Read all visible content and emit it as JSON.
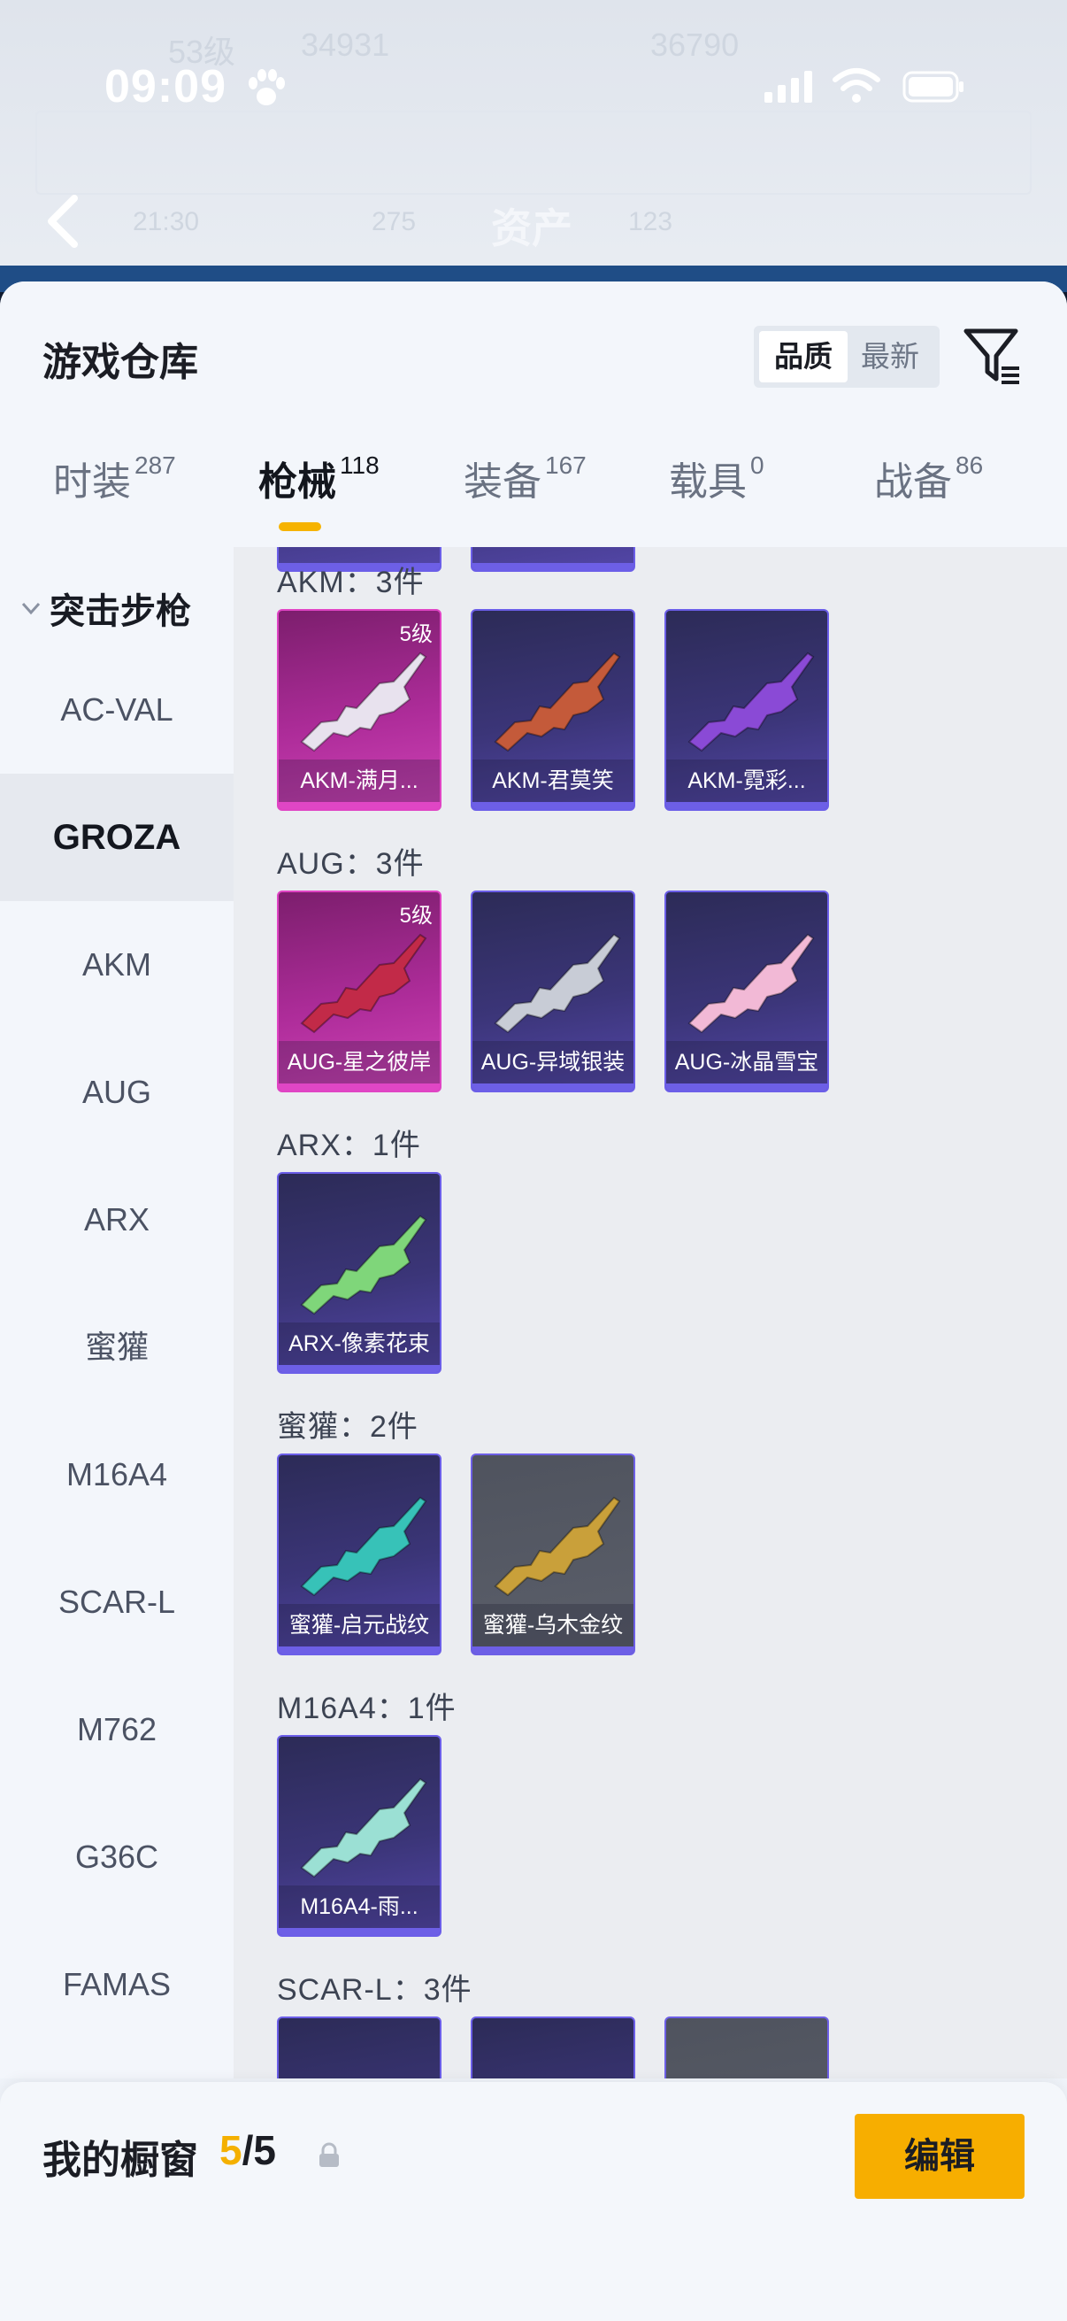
{
  "status_bar": {
    "time": "09:09"
  },
  "background_header": {
    "title": "资产",
    "ghost_text": [
      "53级",
      "34931",
      "36790",
      "21:30",
      "275",
      "123"
    ]
  },
  "sheet": {
    "title": "游戏仓库",
    "sort": {
      "options": [
        "品质",
        "最新"
      ],
      "selected": "品质"
    }
  },
  "tabs": [
    {
      "label": "时装",
      "count": "287"
    },
    {
      "label": "枪械",
      "count": "118",
      "active": true
    },
    {
      "label": "装备",
      "count": "167"
    },
    {
      "label": "载具",
      "count": "0"
    },
    {
      "label": "战备",
      "count": "86"
    }
  ],
  "sidebar": {
    "section": "突击步枪",
    "items": [
      "AC-VAL",
      "GROZA",
      "AKM",
      "AUG",
      "ARX",
      "蜜獾",
      "M16A4",
      "SCAR-L",
      "M762",
      "G36C",
      "FAMAS"
    ],
    "selected": "GROZA"
  },
  "groups": [
    {
      "title": "AKM：3件",
      "items": [
        {
          "name": "AKM-满月...",
          "rarity": "pink",
          "level": "5级",
          "gun_color": "#e8e2ee"
        },
        {
          "name": "AKM-君莫笑",
          "rarity": "purple",
          "gun_color": "#c45a3a"
        },
        {
          "name": "AKM-霓彩...",
          "rarity": "purple",
          "gun_color": "#8a4ad6"
        }
      ]
    },
    {
      "title": "AUG：3件",
      "items": [
        {
          "name": "AUG-星之彼岸",
          "rarity": "pink",
          "level": "5级",
          "gun_color": "#c22a48"
        },
        {
          "name": "AUG-异域银装",
          "rarity": "purple",
          "gun_color": "#c8ccd6"
        },
        {
          "name": "AUG-冰晶雪宝",
          "rarity": "purple",
          "gun_color": "#f2b9d6"
        }
      ]
    },
    {
      "title": "ARX：1件",
      "items": [
        {
          "name": "ARX-像素花束",
          "rarity": "purple",
          "gun_color": "#7fd67a"
        }
      ]
    },
    {
      "title": "蜜獾：2件",
      "items": [
        {
          "name": "蜜獾-启元战纹",
          "rarity": "purple",
          "gun_color": "#37c2b8"
        },
        {
          "name": "蜜獾-乌木金纹",
          "rarity": "grey",
          "gun_color": "#c9a03a"
        }
      ]
    },
    {
      "title": "M16A4：1件",
      "items": [
        {
          "name": "M16A4-雨...",
          "rarity": "purple",
          "gun_color": "#9be0d4"
        }
      ]
    },
    {
      "title": "SCAR-L：3件",
      "items": [
        {
          "name": "",
          "rarity": "purple"
        },
        {
          "name": "",
          "rarity": "purple"
        },
        {
          "name": "",
          "rarity": "grey"
        }
      ]
    }
  ],
  "showcase": {
    "title": "我的橱窗",
    "current": "5",
    "total": "5",
    "edit_label": "编辑"
  },
  "colors": {
    "accent": "#f7ae00",
    "epic": "#6d5fe6",
    "legendary": "#e046c5"
  }
}
